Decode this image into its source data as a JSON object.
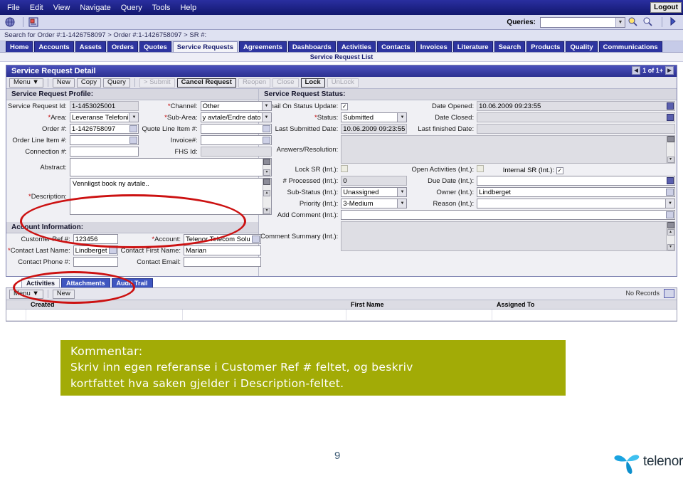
{
  "menubar": {
    "items": [
      "File",
      "Edit",
      "View",
      "Navigate",
      "Query",
      "Tools",
      "Help"
    ],
    "logout_label": "Logout"
  },
  "toolbar": {
    "globe_icon": "globe-icon",
    "site_map_icon": "site-map-icon",
    "queries_label": "Queries:",
    "queries_value": "",
    "run_query_icon": "run-query-icon",
    "new_query_icon": "new-query-icon",
    "next_icon": "next-icon"
  },
  "breadcrumb": {
    "text": "Search for Order #:1-1426758097  > Order #:1-1426758097  > SR #:"
  },
  "tabs": [
    {
      "label": "Home",
      "active": false
    },
    {
      "label": "Accounts",
      "active": false
    },
    {
      "label": "Assets",
      "active": false
    },
    {
      "label": "Orders",
      "active": false
    },
    {
      "label": "Quotes",
      "active": false
    },
    {
      "label": "Service Requests",
      "active": true
    },
    {
      "label": "Agreements",
      "active": false
    },
    {
      "label": "Dashboards",
      "active": false
    },
    {
      "label": "Activities",
      "active": false
    },
    {
      "label": "Contacts",
      "active": false
    },
    {
      "label": "Invoices",
      "active": false
    },
    {
      "label": "Literature",
      "active": false
    },
    {
      "label": "Search",
      "active": false
    },
    {
      "label": "Products",
      "active": false
    },
    {
      "label": "Quality",
      "active": false
    },
    {
      "label": "Communications",
      "active": false
    }
  ],
  "sublink": {
    "label": "Service Request List"
  },
  "applet": {
    "title": "Service Request Detail",
    "pager": {
      "prev_icon": "prev-record-icon",
      "text": "1 of 1+",
      "next_icon": "next-record-icon"
    },
    "buttons": [
      {
        "label": "Menu ▼",
        "state": "enabled"
      },
      {
        "label": "New",
        "state": "enabled"
      },
      {
        "label": "Copy",
        "state": "enabled"
      },
      {
        "label": "Query",
        "state": "enabled"
      },
      {
        "label": "> Submit",
        "state": "disabled"
      },
      {
        "label": "Cancel Request",
        "state": "strong"
      },
      {
        "label": "Reopen",
        "state": "disabled"
      },
      {
        "label": "Close",
        "state": "disabled"
      },
      {
        "label": "Lock",
        "state": "strong"
      },
      {
        "label": "UnLock",
        "state": "disabled"
      }
    ]
  },
  "profile": {
    "header": "Service Request Profile:",
    "service_request_id_label": "Service Request Id:",
    "service_request_id_value": "1-1453025001",
    "area_label": "Area:",
    "area_value": "Leveranse Telefoni",
    "order_label": "Order #:",
    "order_value": "1-1426758097",
    "order_line_item_label": "Order Line Item #:",
    "order_line_item_value": "",
    "connection_label": "Connection #:",
    "connection_value": "",
    "abstract_label": "Abstract:",
    "abstract_value": "",
    "description_label": "Description:",
    "description_value": "Vennligst book ny avtale..",
    "channel_label": "Channel:",
    "channel_value": "Other",
    "sub_area_label": "Sub-Area:",
    "sub_area_value": "y avtale/Endre dato",
    "quote_line_item_label": "Quote Line Item #:",
    "quote_line_item_value": "",
    "invoice_label": "Invoice#:",
    "invoice_value": "",
    "fhs_id_label": "FHS Id:",
    "fhs_id_value": ""
  },
  "status": {
    "header": "Service Request Status:",
    "email_on_status_update_label": "Email On Status Update:",
    "email_on_status_update_checked": true,
    "status_label": "Status:",
    "status_value": "Submitted",
    "last_submitted_date_label": "Last Submitted Date:",
    "last_submitted_date_value": "10.06.2009 09:23:55",
    "answers_resolution_label": "Answers/Resolution:",
    "answers_resolution_value": "",
    "date_opened_label": "Date Opened:",
    "date_opened_value": "10.06.2009 09:23:55",
    "date_closed_label": "Date Closed:",
    "date_closed_value": "",
    "last_finished_date_label": "Last finished Date:",
    "last_finished_date_value": "",
    "lock_sr_label": "Lock SR (Int.):",
    "lock_sr_checked": false,
    "open_activities_label": "Open Activities (Int.):",
    "open_activities_checked": false,
    "internal_sr_label": "Internal SR (Int.):",
    "internal_sr_checked": true,
    "num_processed_label": "# Processed (Int.):",
    "num_processed_value": "0",
    "due_date_label": "Due Date (Int.):",
    "due_date_value": "",
    "sub_status_label": "Sub-Status (Int.):",
    "sub_status_value": "Unassigned",
    "owner_label": "Owner (Int.):",
    "owner_value": "Lindberget",
    "priority_label": "Priority (Int.):",
    "priority_value": "3-Medium",
    "reason_label": "Reason (Int.):",
    "reason_value": "",
    "add_comment_label": "Add Comment (Int.):",
    "add_comment_value": "",
    "comment_summary_label": "Comment Summary (Int.):",
    "comment_summary_value": ""
  },
  "account": {
    "header": "Account Information:",
    "customer_ref_label": "Customer Ref #:",
    "customer_ref_value": "123456",
    "contact_last_name_label": "Contact Last Name:",
    "contact_last_name_value": "Lindberget",
    "contact_phone_label": "Contact Phone #:",
    "contact_phone_value": "",
    "account_label": "Account:",
    "account_value": "Telenor Telecom Solu",
    "contact_first_name_label": "Contact First Name:",
    "contact_first_name_value": "Marian",
    "contact_email_label": "Contact Email:",
    "contact_email_value": ""
  },
  "list_applet": {
    "tabs": [
      {
        "label": "Activities",
        "active": true
      },
      {
        "label": "Attachments",
        "active": false
      },
      {
        "label": "Audit Trail",
        "active": false
      }
    ],
    "menu_label": "Menu ▼",
    "new_label": "New",
    "no_records_label": "No Records",
    "columns": [
      "Created",
      "First Name",
      "Assigned To"
    ]
  },
  "annotation": {
    "line1": "Kommentar:",
    "line2": "Skriv inn egen referanse i Customer Ref #  feltet, og beskriv",
    "line3": "kortfattet hva saken gjelder i Description-feltet.",
    "background_color": "#a2ab06",
    "highlight_color": "#cc1111"
  },
  "footer": {
    "page_number": "9",
    "brand": "telenor",
    "brand_color": "#1aa3e0"
  }
}
